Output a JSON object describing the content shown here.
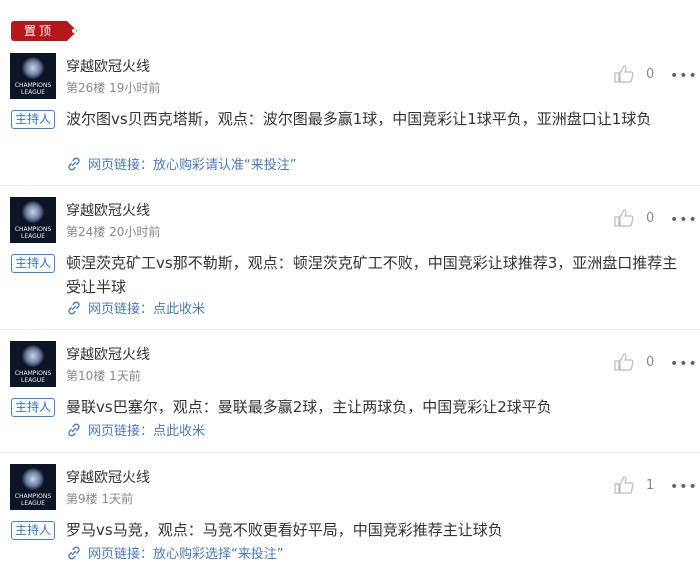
{
  "pinned_label": "置顶",
  "posts": [
    {
      "user": "穿越欧冠火线",
      "meta": "第26楼 19小时前",
      "likes": "0",
      "role": "主持人",
      "content": "波尔图vs贝西克塔斯，观点：波尔图最多赢1球，中国竞彩让1球平负，亚洲盘口让1球负",
      "link": "网页链接：放心购彩请认准“来投注”"
    },
    {
      "user": "穿越欧冠火线",
      "meta": "第24楼 20小时前",
      "likes": "0",
      "role": "主持人",
      "content": "顿涅茨克矿工vs那不勒斯，观点：顿涅茨克矿工不败，中国竞彩让球推荐3，亚洲盘口推荐主受让半球",
      "link": "网页链接：点此收米"
    },
    {
      "user": "穿越欧冠火线",
      "meta": "第10楼 1天前",
      "likes": "0",
      "role": "主持人",
      "content": "曼联vs巴塞尔，观点：曼联最多赢2球，主让两球负，中国竞彩让2球平负",
      "link": "网页链接：点此收米"
    },
    {
      "user": "穿越欧冠火线",
      "meta": "第9楼 1天前",
      "likes": "1",
      "role": "主持人",
      "content": "罗马vs马竞，观点：马竞不败更看好平局，中国竞彩推荐主让球负",
      "link": "网页链接：放心购彩选择“来投注”"
    }
  ],
  "more_glyph": "•••",
  "avatar_text": "CHAMPIONS LEAGUE",
  "colors": {
    "pin": "#b8161d",
    "link": "#4a78bc",
    "badge": "#3a72c8"
  },
  "icons": {
    "like": "thumbs-up-icon",
    "more": "more-dots-icon",
    "link": "link-chain-icon"
  }
}
